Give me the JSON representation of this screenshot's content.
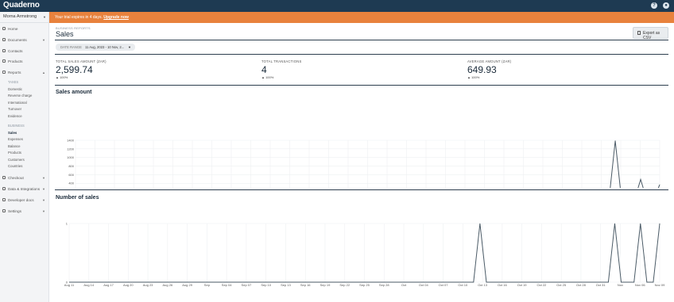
{
  "app": {
    "logo": "Quaderno"
  },
  "topbar": {
    "help_icon": "help-icon",
    "user_icon": "user-icon"
  },
  "sidebar": {
    "account_name": "Morna Armstrong",
    "items": [
      {
        "label": "Home",
        "icon": "home-icon"
      },
      {
        "label": "Documents",
        "icon": "documents-icon"
      },
      {
        "label": "Contacts",
        "icon": "contacts-icon"
      },
      {
        "label": "Products",
        "icon": "products-icon"
      },
      {
        "label": "Reports",
        "icon": "reports-icon"
      }
    ],
    "reports_sections": {
      "taxes_head": "TAXES",
      "taxes": [
        "Domestic",
        "Reverse charge",
        "International",
        "Turnover",
        "Evidence"
      ],
      "business_head": "BUSINESS",
      "business": [
        "Sales",
        "Expenses",
        "Balance",
        "Products",
        "Customers",
        "Countries"
      ]
    },
    "bottom_items": [
      {
        "label": "Checkout",
        "icon": "checkout-icon"
      },
      {
        "label": "Data & Integrations",
        "icon": "integrations-icon"
      },
      {
        "label": "Developer docs",
        "icon": "developer-icon"
      },
      {
        "label": "Settings",
        "icon": "settings-icon"
      }
    ]
  },
  "banner": {
    "text": "Your trial expires in 4 days.",
    "link": "Upgrade now"
  },
  "header": {
    "breadcrumb": "BUSINESS REPORTS",
    "title": "Sales",
    "export_label": "Export as CSV"
  },
  "filter": {
    "label": "DATE RANGE",
    "value": "11 Aug, 2023 - 10 Nov, 2..."
  },
  "stats": [
    {
      "label": "TOTAL SALES AMOUNT (ZAR)",
      "value": "2,599.74",
      "change": "▲ 100%"
    },
    {
      "label": "TOTAL TRANSACTIONS",
      "value": "4",
      "change": "▲ 100%"
    },
    {
      "label": "AVERAGE AMOUNT (ZAR)",
      "value": "649.93",
      "change": "▲ 100%"
    }
  ],
  "chart_data": [
    {
      "type": "line",
      "title": "Sales amount",
      "x": [
        "Aug 11",
        "Aug 14",
        "Aug 17",
        "Aug 20",
        "Aug 23",
        "Aug 26",
        "Aug 29",
        "Sep",
        "Sep 04",
        "Sep 07",
        "Sep 10",
        "Sep 13",
        "Sep 16",
        "Sep 19",
        "Sep 22",
        "Sep 25",
        "Sep 28",
        "Oct",
        "Oct 04",
        "Oct 07",
        "Oct 10",
        "Oct 13",
        "Oct 16",
        "Oct 19",
        "Oct 22",
        "Oct 25",
        "Oct 28",
        "Oct 31",
        "Nov",
        "Nov 06",
        "Nov 09"
      ],
      "yticks": [
        0,
        200,
        400,
        600,
        800,
        1000,
        1200,
        1400
      ],
      "ylim": [
        0,
        1400
      ],
      "points": [
        {
          "day": 0,
          "value": 0
        },
        {
          "day": 63,
          "value": 0
        },
        {
          "day": 64,
          "value": 220
        },
        {
          "day": 65,
          "value": 0
        },
        {
          "day": 84,
          "value": 0
        },
        {
          "day": 85,
          "value": 1390
        },
        {
          "day": 86,
          "value": 0
        },
        {
          "day": 88,
          "value": 0
        },
        {
          "day": 89,
          "value": 490
        },
        {
          "day": 90,
          "value": 0
        },
        {
          "day": 91,
          "value": 0
        },
        {
          "day": 92,
          "value": 370
        }
      ],
      "color": "#4a5a66"
    },
    {
      "type": "line",
      "title": "Number of sales",
      "x": [
        "Aug 11",
        "Aug 14",
        "Aug 17",
        "Aug 20",
        "Aug 23",
        "Aug 26",
        "Aug 29",
        "Sep",
        "Sep 04",
        "Sep 07",
        "Sep 10",
        "Sep 13",
        "Sep 16",
        "Sep 19",
        "Sep 22",
        "Sep 25",
        "Sep 28",
        "Oct",
        "Oct 04",
        "Oct 07",
        "Oct 10",
        "Oct 13",
        "Oct 16",
        "Oct 19",
        "Oct 22",
        "Oct 25",
        "Oct 28",
        "Oct 31",
        "Nov",
        "Nov 06",
        "Nov 09"
      ],
      "yticks": [
        0,
        1
      ],
      "ylim": [
        0,
        1
      ],
      "points": [
        {
          "day": 0,
          "value": 0
        },
        {
          "day": 63,
          "value": 0
        },
        {
          "day": 64,
          "value": 1
        },
        {
          "day": 65,
          "value": 0
        },
        {
          "day": 84,
          "value": 0
        },
        {
          "day": 85,
          "value": 1
        },
        {
          "day": 86,
          "value": 0
        },
        {
          "day": 88,
          "value": 0
        },
        {
          "day": 89,
          "value": 1
        },
        {
          "day": 90,
          "value": 0
        },
        {
          "day": 91,
          "value": 0
        },
        {
          "day": 92,
          "value": 1
        }
      ],
      "color": "#4a5a66"
    }
  ]
}
